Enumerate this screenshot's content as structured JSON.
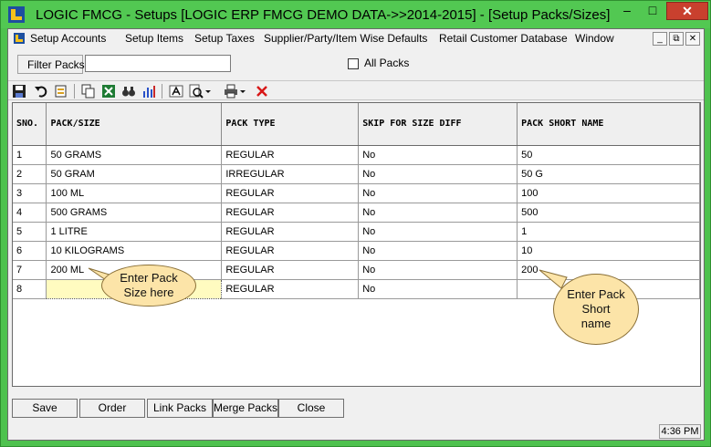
{
  "window": {
    "title": "LOGIC FMCG - Setups  [LOGIC ERP FMCG DEMO DATA->>2014-2015] - [Setup Packs/Sizes]",
    "minimize_glyph": "–",
    "maximize_glyph": "□",
    "close_glyph": "✕"
  },
  "menu": {
    "items": [
      "Setup Accounts",
      "Setup Items",
      "Setup Taxes",
      "Supplier/Party/Item Wise Defaults",
      "Retail Customer Database",
      "Window"
    ],
    "mdi_minimize": "_",
    "mdi_restore": "⧉",
    "mdi_close": "✕"
  },
  "filter": {
    "label": "Filter Packs",
    "value": "",
    "all_packs_label": "All Packs",
    "all_packs_checked": false
  },
  "toolbar": {
    "icons": [
      "save-icon",
      "undo-icon",
      "print-preview-icon",
      "copy-icon",
      "excel-icon",
      "find-icon",
      "chart-icon",
      "font-icon",
      "zoom-icon",
      "printer-icon",
      "delete-icon"
    ]
  },
  "grid": {
    "headers": [
      "SNO.",
      "PACK/SIZE",
      "PACK TYPE",
      "SKIP FOR SIZE DIFF",
      "PACK SHORT NAME"
    ],
    "rows": [
      [
        "1",
        "50 GRAMS",
        "REGULAR",
        "No",
        "50"
      ],
      [
        "2",
        "50 GRAM",
        "IRREGULAR",
        "No",
        "50 G"
      ],
      [
        "3",
        "100 ML",
        "REGULAR",
        "No",
        "100"
      ],
      [
        "4",
        "500 GRAMS",
        "REGULAR",
        "No",
        "500"
      ],
      [
        "5",
        "1 LITRE",
        "REGULAR",
        "No",
        "1"
      ],
      [
        "6",
        "10 KILOGRAMS",
        "REGULAR",
        "No",
        "10"
      ],
      [
        "7",
        "200 ML",
        "REGULAR",
        "No",
        "200"
      ],
      [
        "8",
        "",
        "REGULAR",
        "No",
        ""
      ]
    ]
  },
  "callouts": {
    "pack_size": "Enter Pack Size here",
    "short_name": "Enter Pack Short name"
  },
  "buttons": [
    "Save",
    "Order",
    "Link Packs",
    "Merge Packs",
    "Close"
  ],
  "status": {
    "time": "4:36 PM"
  },
  "colors": {
    "title_bar": "#52c852",
    "close_button": "#c9402e",
    "callout_fill": "#fce4a8",
    "edit_cell": "#fffbc0"
  }
}
